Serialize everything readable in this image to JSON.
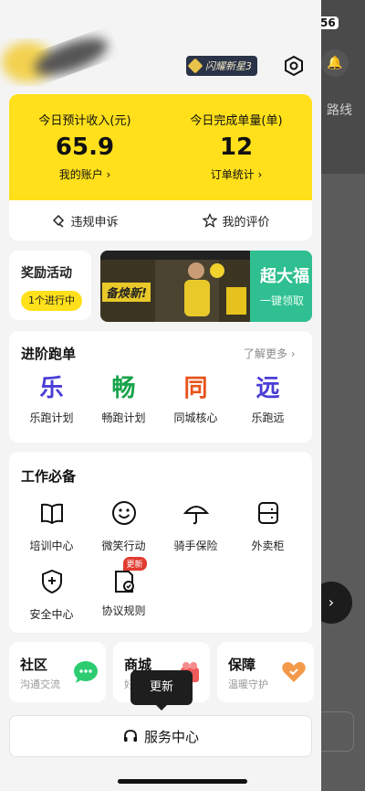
{
  "background_app": {
    "status_text": "56",
    "route_label": "路线"
  },
  "header": {
    "badge_label": "闪耀新星3"
  },
  "income": {
    "today_income_label": "今日预计收入(元)",
    "today_income_value": "65.9",
    "account_link": "我的账户 ›",
    "today_orders_label": "今日完成单量(单)",
    "today_orders_value": "12",
    "order_stats_link": "订单统计 ›"
  },
  "report_row": {
    "violation_appeal": "违规申诉",
    "my_rating": "我的评价"
  },
  "reward": {
    "title": "奖励活动",
    "pill": "1个进行中",
    "banner_left_text": "备焕新!",
    "banner_right_title": "超大福",
    "banner_right_sub": "一键领取"
  },
  "advance": {
    "title": "进阶跑单",
    "more": "了解更多 ›",
    "items": [
      {
        "char": "乐",
        "label": "乐跑计划",
        "color": "#4a3dd6"
      },
      {
        "char": "畅",
        "label": "畅跑计划",
        "color": "#16a34a"
      },
      {
        "char": "同",
        "label": "同城核心",
        "color": "#e8531a"
      },
      {
        "char": "远",
        "label": "乐跑远",
        "color": "#4a3dd6"
      }
    ]
  },
  "tools": {
    "title": "工作必备",
    "items": [
      {
        "label": "培训中心",
        "icon": "book-icon"
      },
      {
        "label": "微笑行动",
        "icon": "smile-icon"
      },
      {
        "label": "骑手保险",
        "icon": "umbrella-icon"
      },
      {
        "label": "外卖柜",
        "icon": "locker-icon"
      },
      {
        "label": "安全中心",
        "icon": "shield-icon"
      },
      {
        "label": "协议规则",
        "icon": "agreement-icon",
        "tag": "更新"
      }
    ]
  },
  "bottom_cards": [
    {
      "title": "社区",
      "sub": "沟通交流"
    },
    {
      "title": "商城",
      "sub": "好物"
    },
    {
      "title": "保障",
      "sub": "温暖守护"
    }
  ],
  "tooltip": "更新",
  "service_center": "服务中心"
}
